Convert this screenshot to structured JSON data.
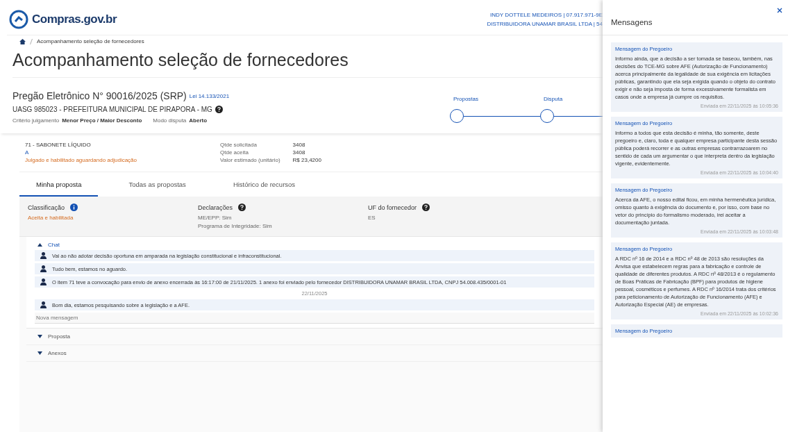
{
  "header": {
    "logo_text": "Compras.gov.br",
    "user_lines": [
      "INDY DOTTELE MEDEIROS | 07.917.971-9E",
      "DISTRIBUIDORA UNAMAR BRASIL LTDA | 54"
    ]
  },
  "breadcrumb": [
    "Acompanhamento seleção de fornecedores"
  ],
  "page_title": "Acompanhamento seleção de fornecedores",
  "pregao": {
    "title": "Pregão Eletrônico N° 90016/2025 (SRP)",
    "law": "Lei 14.133/2021",
    "uasg": "UASG 985023 - PREFEITURA MUNICIPAL DE PIRAPORA - MG",
    "criteria_label": "Critério julgamento",
    "criteria_value": "Menor Preço / Maior Desconto",
    "mode_label": "Modo disputa",
    "mode_value": "Aberto"
  },
  "stepper": [
    {
      "label": "Propostas"
    },
    {
      "label": "Disputa"
    }
  ],
  "item": {
    "name": "71 - SABONETE LÍQUIDO",
    "code": "A",
    "status": "Julgado e habilitado aguardando adjudicação",
    "facts": [
      {
        "label": "Qtde solicitada",
        "value": "3408"
      },
      {
        "label": "Qtde aceita",
        "value": "3408"
      },
      {
        "label": "Valor estimado (unitário)",
        "value": "R$ 23,4200"
      }
    ]
  },
  "tabs": [
    {
      "label": "Minha proposta",
      "selected": true
    },
    {
      "label": "Todas as propostas",
      "selected": false
    },
    {
      "label": "Histórico de recursos",
      "selected": false
    }
  ],
  "summary": [
    {
      "label": "Classificação",
      "lines": [
        "Aceita e habilitada"
      ],
      "kind": "status"
    },
    {
      "label": "Declarações",
      "lines": [
        "ME/EPP: Sim",
        "Programa de Integridade: Sim"
      ],
      "kind": "plain"
    },
    {
      "label": "UF do fornecedor",
      "lines": [
        "ES"
      ],
      "kind": "plain"
    }
  ],
  "chat": {
    "title": "Chat",
    "expanded": true,
    "messages": [
      {
        "kind": "message",
        "text": "Vai ao não adotar decisão oportuna em amparada na legislação constitucional e infraconstitucional."
      },
      {
        "kind": "message",
        "text": "Tudo bem, estamos no aguardo."
      },
      {
        "kind": "message",
        "text": "O item 71 teve a convocação para envio de anexo encerrada às 16:17:00 de 21/11/2025. 1 anexo foi enviado pelo fornecedor DISTRIBUIDORA UNAMAR BRASIL LTDA, CNPJ 54.008.435/0001-01"
      },
      {
        "kind": "date",
        "text": "22/11/2025"
      },
      {
        "kind": "message",
        "text": "Bom dia, estamos pesquisando sobre a legislação e a AFE."
      }
    ],
    "placeholder": "Nova mensagem"
  },
  "sections": [
    {
      "title": "Proposta",
      "expanded": false
    },
    {
      "title": "Anexos",
      "expanded": false
    }
  ],
  "panel": {
    "title": "Mensagens",
    "messages": [
      {
        "author": "Mensagem do Pregoeiro",
        "text": "Informo ainda, que a decisão a ser tomada se baseou, também, nas decisões do TCE-MG sobre AFE (Autorização de Funcionamento) acerca principalmente da legalidade de sua exigência em licitações públicas, garantindo que ela seja exigida quando o objeto do contrato exigir e não seja imposta de forma excessivamente formalista em casos onde a empresa já cumpre os requisitos.",
        "time": "Enviada em 22/11/2025 às 10:05:36"
      },
      {
        "author": "Mensagem do Pregoeiro",
        "text": "Informo a todos que esta decisão é minha, tão somente, deste pregoeiro e, claro, toda e qualquer empresa participante desta sessão pública poderá recorrer e as outras empresas contrarrazoarem no sentido de cada um argumentar o que interpreta dentro da legislação vigente, evidentemente.",
        "time": "Enviada em 22/11/2025 às 10:04:40"
      },
      {
        "author": "Mensagem do Pregoeiro",
        "text": "Acerca da AFE, o nosso edital ficou, em minha hermenêutica jurídica, omisso quanto à exigência do documento e, por isso, com base no vetor do princípio do formalismo moderado, irei aceitar a documentação juntada.",
        "time": "Enviada em 22/11/2025 às 10:03:48"
      },
      {
        "author": "Mensagem do Pregoeiro",
        "text": "A RDC nº 16 de 2014 e a RDC nº 48 de 2013 são resoluções da Anvisa que estabelecem regras para a fabricação e controle de qualidade de diferentes produtos. A RDC nº 48/2013 é o regulamento de Boas Práticas de Fabricação (BPF) para produtos de higiene pessoal, cosméticos e perfumes. A RDC nº 16/2014 trata dos critérios para peticionamento de Autorização de Funcionamento (AFE) e Autorização Especial (AE) de empresas.",
        "time": "Enviada em 22/11/2025 às 10:02:36"
      },
      {
        "author": "Mensagem do Pregoeiro"
      }
    ]
  }
}
